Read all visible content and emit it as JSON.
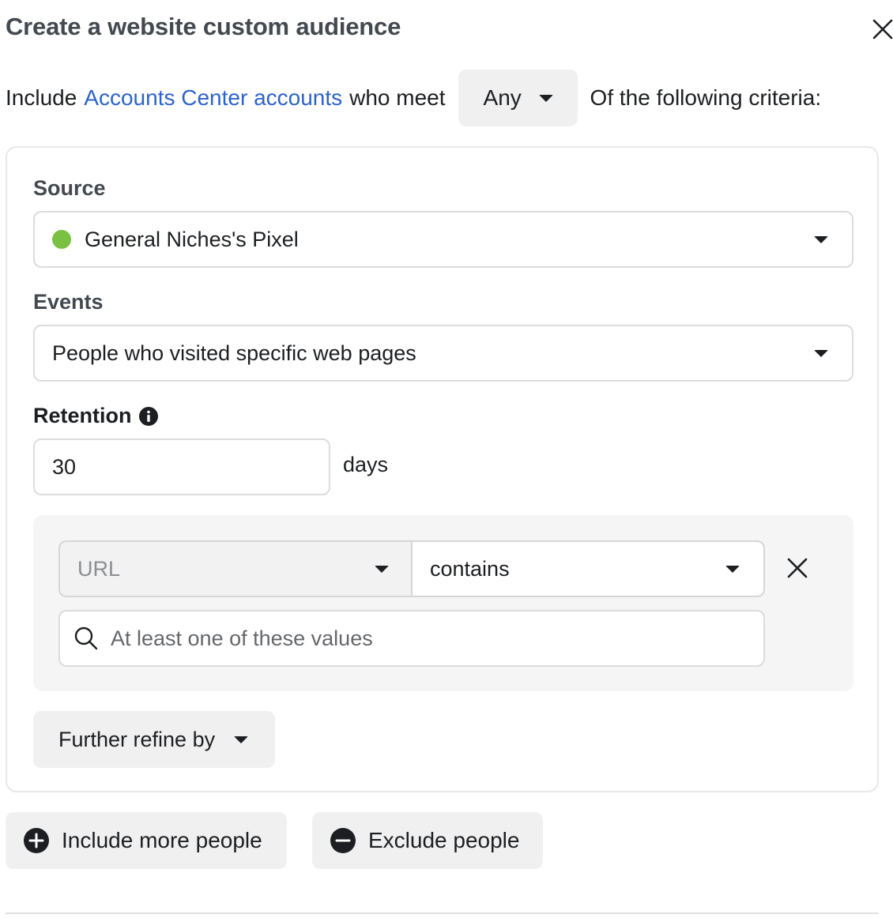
{
  "dialog": {
    "title": "Create a website custom audience",
    "close_icon": "close-icon"
  },
  "include_row": {
    "prefix": "Include",
    "link": "Accounts Center accounts",
    "middle": "who meet",
    "match_select": "Any",
    "suffix": "Of the following criteria:"
  },
  "source": {
    "label": "Source",
    "value": "General Niches's Pixel",
    "status_color": "#7ac143"
  },
  "events": {
    "label": "Events",
    "value": "People who visited specific web pages"
  },
  "retention": {
    "label": "Retention",
    "info_icon": "info-icon",
    "value": "30",
    "unit": "days"
  },
  "rule": {
    "field": "URL",
    "operator": "contains",
    "values_placeholder": "At least one of these values"
  },
  "refine": {
    "label": "Further refine by"
  },
  "actions": {
    "include_more": "Include more people",
    "exclude": "Exclude people"
  },
  "colors": {
    "link": "#2d63c8",
    "button_bg": "#f0f0f0"
  }
}
